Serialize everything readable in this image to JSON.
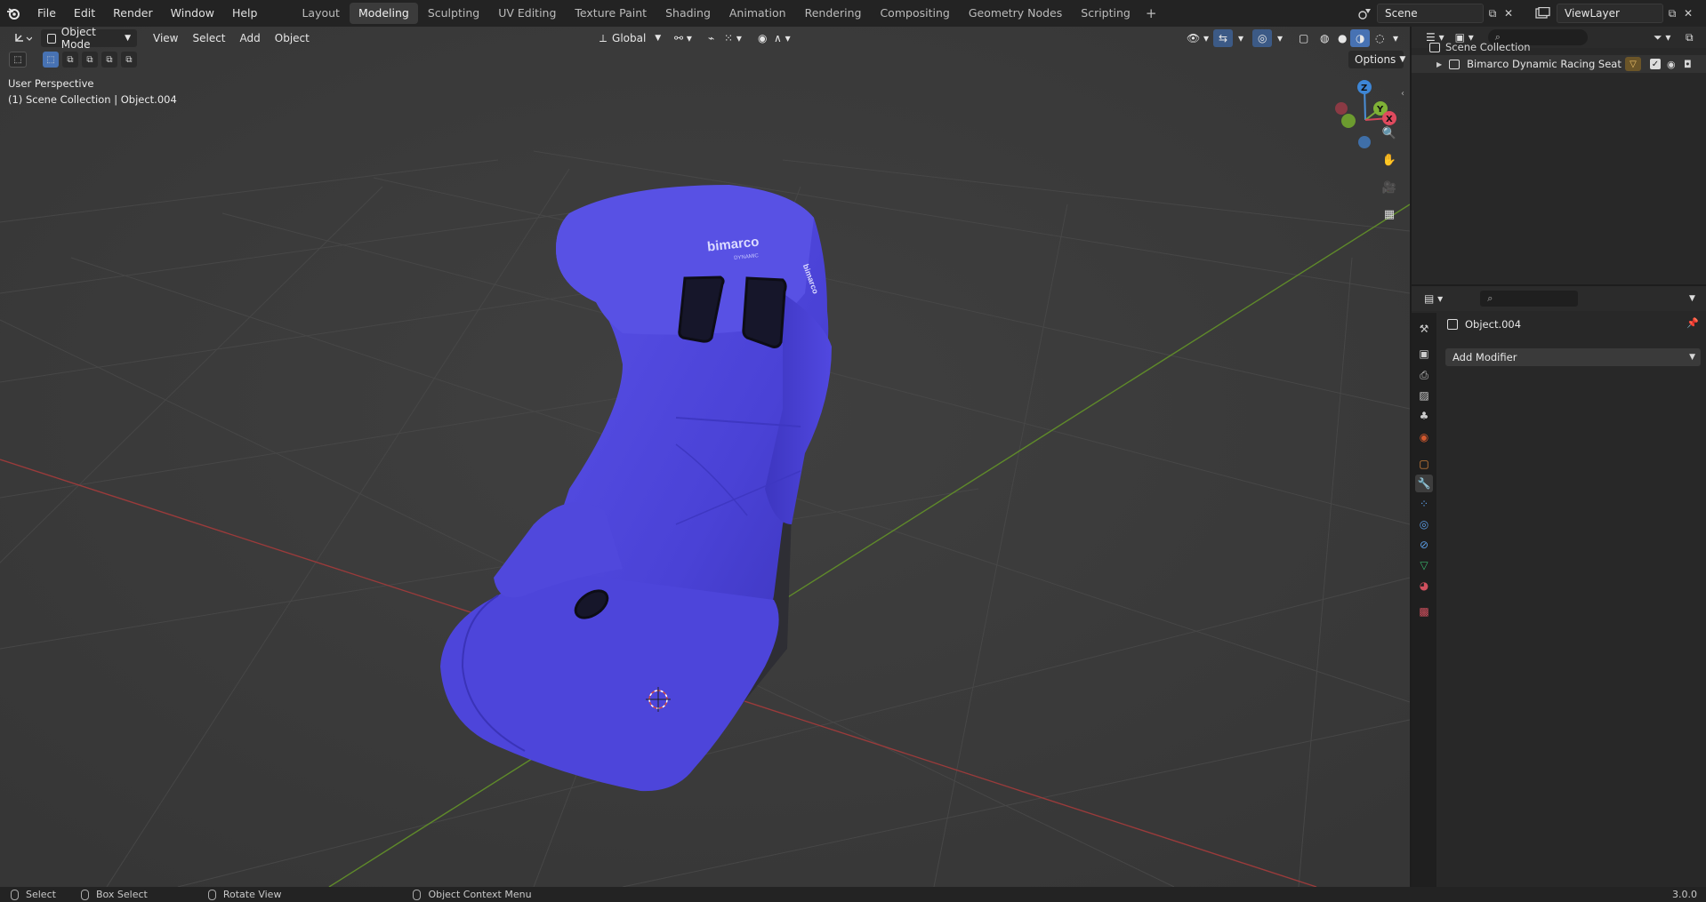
{
  "topbar": {
    "menu": [
      "File",
      "Edit",
      "Render",
      "Window",
      "Help"
    ],
    "workspaces": [
      "Layout",
      "Modeling",
      "Sculpting",
      "UV Editing",
      "Texture Paint",
      "Shading",
      "Animation",
      "Rendering",
      "Compositing",
      "Geometry Nodes",
      "Scripting"
    ],
    "active_workspace": "Modeling",
    "scene": "Scene",
    "view_layer": "ViewLayer"
  },
  "viewport": {
    "mode": "Object Mode",
    "menu": [
      "View",
      "Select",
      "Add",
      "Object"
    ],
    "transform_orientation": "Global",
    "options_label": "Options",
    "perspective_label": "User Perspective",
    "collection_label": "(1) Scene Collection | Object.004",
    "gizmo": {
      "x": "X",
      "y": "Y",
      "z": "Z"
    },
    "seat_logo": "bimarco",
    "seat_sublogo": "DYNAMIC"
  },
  "outliner": {
    "root": "Scene Collection",
    "items": [
      {
        "label": "Bimarco Dynamic Racing Seat"
      }
    ]
  },
  "properties": {
    "object_name": "Object.004",
    "add_modifier": "Add Modifier"
  },
  "statusbar": {
    "items": [
      "Select",
      "Box Select",
      "Rotate View",
      "Object Context Menu"
    ],
    "version": "3.0.0"
  },
  "colors": {
    "viewport_bg": "#3d3d3d",
    "seat_blue": "#4a42d6",
    "axis_red": "#9a3b3b",
    "axis_green": "#5f8a2a",
    "accent_blue": "#4772b3"
  }
}
